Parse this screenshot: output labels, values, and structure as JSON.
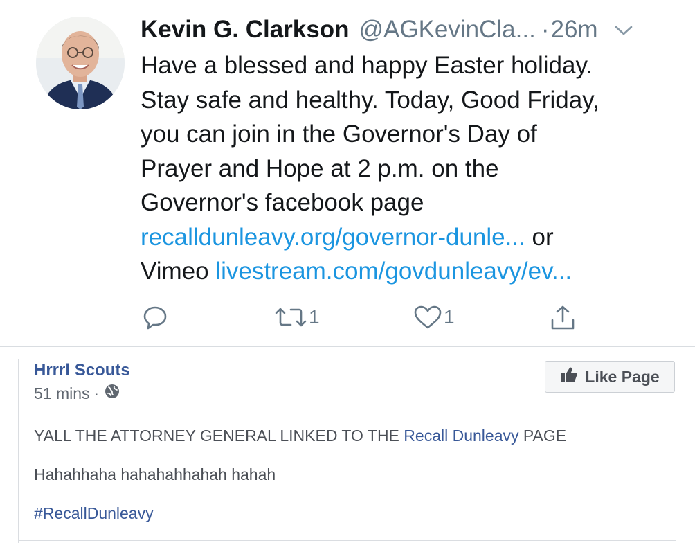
{
  "tweet": {
    "display_name": "Kevin G. Clarkson",
    "handle": "@AGKevinCla...",
    "dot": "·",
    "time": "26m",
    "text_lines": [
      "Have a blessed and happy Easter holiday.",
      "Stay safe and healthy.  Today, Good Friday,",
      "you can join in the Governor's Day of",
      "Prayer and Hope at 2 p.m. on the",
      "Governor's facebook page"
    ],
    "link1": "recalldunleavy.org/governor-dunle...",
    "link1_suffix": " or",
    "vimeo_prefix": "Vimeo ",
    "link2": "livestream.com/govdunleavy/ev...",
    "retweet_count": "1",
    "like_count": "1",
    "icons": [
      "avatar",
      "chevron-down-icon",
      "reply-icon",
      "retweet-icon",
      "heart-icon",
      "share-icon"
    ],
    "link_color": "#1b95e0"
  },
  "fb_post": {
    "page_name": "Hrrrl Scouts",
    "time": "51 mins",
    "meta_sep": "·",
    "like_button": "Like Page",
    "line1_prefix": "YALL THE ATTORNEY GENERAL LINKED TO THE ",
    "line1_link": "Recall Dunleavy",
    "line1_suffix": " PAGE",
    "line2": "Hahahhaha hahahahhahah hahah",
    "hashtag": "#RecallDunleavy",
    "icons": [
      "globe-icon",
      "thumbs-up-icon"
    ],
    "link_color": "#385898"
  }
}
